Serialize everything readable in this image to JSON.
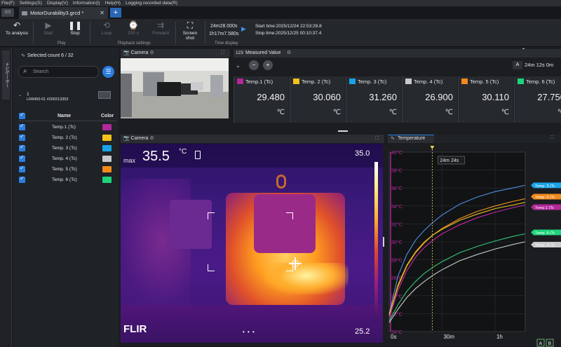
{
  "menu": [
    "File(F)",
    "Settings(S)",
    "Display(V)",
    "Information(I)",
    "Help(H)",
    "Logging recorded data(R)"
  ],
  "file_tab": {
    "title": "MotorDurability3.grcd *",
    "close": "✕",
    "new": "+"
  },
  "toolbar": {
    "to_analysis": "To analysis",
    "play": "Start",
    "stop": "Stop",
    "loop": "Loop",
    "speed": "200 x",
    "forward": "Forward",
    "screenshot": "Screen shot",
    "elapsed": "24m28.000s",
    "position": "1h17m7.580s",
    "start_time": "Start time:2025/12/24 22:53:29.8",
    "stop_time": "Stop time:2025/12/25 00:10:37.4",
    "grp_play": "Play",
    "grp_playback": "Playback settings",
    "grp_time": "Time display"
  },
  "left_strip": {
    "label": "ナビゲーター"
  },
  "channels": {
    "selected": "Selected count 6 / 32",
    "search_placeholder": "Search",
    "device_num": "1",
    "device": "LR8450-01 #200213353",
    "col_name": "Name",
    "col_color": "Color",
    "rows": [
      {
        "name": "Temp.1 (Tc)",
        "color": "#b3289a"
      },
      {
        "name": "Temp. 2 (Tc)",
        "color": "#f2c21b"
      },
      {
        "name": "Temp. 3 (Tc)",
        "color": "#1aa3e8"
      },
      {
        "name": "Temp. 4 (Tc)",
        "color": "#c9c9c9"
      },
      {
        "name": "Temp. 5 (Tc)",
        "color": "#f28a1b"
      },
      {
        "name": "Temp. 6 (Tc)",
        "color": "#1ed47a"
      }
    ]
  },
  "camera_top": {
    "title": "Camera"
  },
  "measured": {
    "title": "Measured Value",
    "badge": "123",
    "a_label": "A",
    "a_time": "24m 12s 0m",
    "cells": [
      {
        "label": "Temp.1 (Tc)",
        "value": "29.480",
        "unit": "℃",
        "color": "#b3289a"
      },
      {
        "label": "Temp. 2 (Tc)",
        "value": "30.060",
        "unit": "℃",
        "color": "#f2c21b"
      },
      {
        "label": "Temp. 3 (Tc)",
        "value": "31.260",
        "unit": "℃",
        "color": "#1aa3e8"
      },
      {
        "label": "Temp. 4 (Tc)",
        "value": "26.900",
        "unit": "℃",
        "color": "#c9c9c9"
      },
      {
        "label": "Temp. 5 (Tc)",
        "value": "30.110",
        "unit": "℃",
        "color": "#f28a1b"
      },
      {
        "label": "Temp. 6 (Tc)",
        "value": "27.750",
        "unit": "℃",
        "color": "#1ed47a"
      }
    ]
  },
  "thermal": {
    "title": "Camera",
    "max_label": "max",
    "max_value": "35.5",
    "unit": "°C",
    "scale_top": "35.0",
    "scale_bottom": "25.2",
    "brand": "FLIR",
    "dots": "• • •"
  },
  "chart_data": {
    "type": "line",
    "title": "Temperature",
    "cursor_label": "24m 24s",
    "ylim": [
      20,
      40
    ],
    "yticks": [
      "40°C",
      "38°C",
      "36°C",
      "34°C",
      "32°C",
      "30°C",
      "28°C",
      "26°C",
      "24°C",
      "22°C",
      "20°C"
    ],
    "xticks": [
      "0s",
      "30m",
      "1h"
    ],
    "x_minutes_ticks": [
      0,
      30,
      60
    ],
    "x_minutes_range": [
      0,
      77.1
    ],
    "cursor_minutes": 24.4,
    "x_minutes": [
      0,
      5,
      10,
      15,
      20,
      25,
      30,
      40,
      50,
      60,
      70,
      77
    ],
    "series": [
      {
        "name": "Temp. 3 (Tc)",
        "color": "#4f8fe0",
        "values": [
          22.0,
          26.2,
          28.6,
          30.2,
          31.3,
          32.2,
          33.0,
          34.2,
          35.0,
          35.6,
          36.0,
          36.3
        ]
      },
      {
        "name": "Temp. 5 (Tc)",
        "color": "#f2951b",
        "values": [
          21.8,
          25.0,
          27.3,
          28.8,
          29.9,
          30.8,
          31.5,
          32.6,
          33.4,
          34.0,
          34.5,
          34.8
        ]
      },
      {
        "name": "Temp. 2 (Tc)",
        "color": "#e6c22a",
        "values": [
          21.9,
          25.2,
          27.4,
          28.9,
          30.0,
          30.8,
          31.4,
          32.4,
          33.1,
          33.7,
          34.1,
          34.4
        ]
      },
      {
        "name": "Temp.1 (Tc)",
        "color": "#c02aa5",
        "values": [
          21.5,
          24.6,
          26.8,
          28.3,
          29.4,
          30.2,
          30.9,
          31.9,
          32.7,
          33.3,
          33.8,
          34.1
        ]
      },
      {
        "name": "Temp. 6 (Tc)",
        "color": "#33c97a",
        "values": [
          21.2,
          23.0,
          24.5,
          25.6,
          26.5,
          27.2,
          27.8,
          28.8,
          29.5,
          30.1,
          30.6,
          30.9
        ]
      },
      {
        "name": "Temp. 4 (Tc)",
        "color": "#c9c9c9",
        "values": [
          21.0,
          22.5,
          23.8,
          24.8,
          25.6,
          26.3,
          26.9,
          27.9,
          28.6,
          29.2,
          29.7,
          30.0
        ]
      }
    ],
    "legend_tags": [
      "Temp. 3 (Tc",
      "Temp. 5 (Tc",
      "Temp.1 (Tc",
      "Temp. 6 (Tc",
      "Temp. 4 (Tc"
    ],
    "footer_a": "A",
    "footer_b": "B"
  },
  "colors": {
    "accent": "#2a7de0",
    "panel": "#1f2226"
  }
}
